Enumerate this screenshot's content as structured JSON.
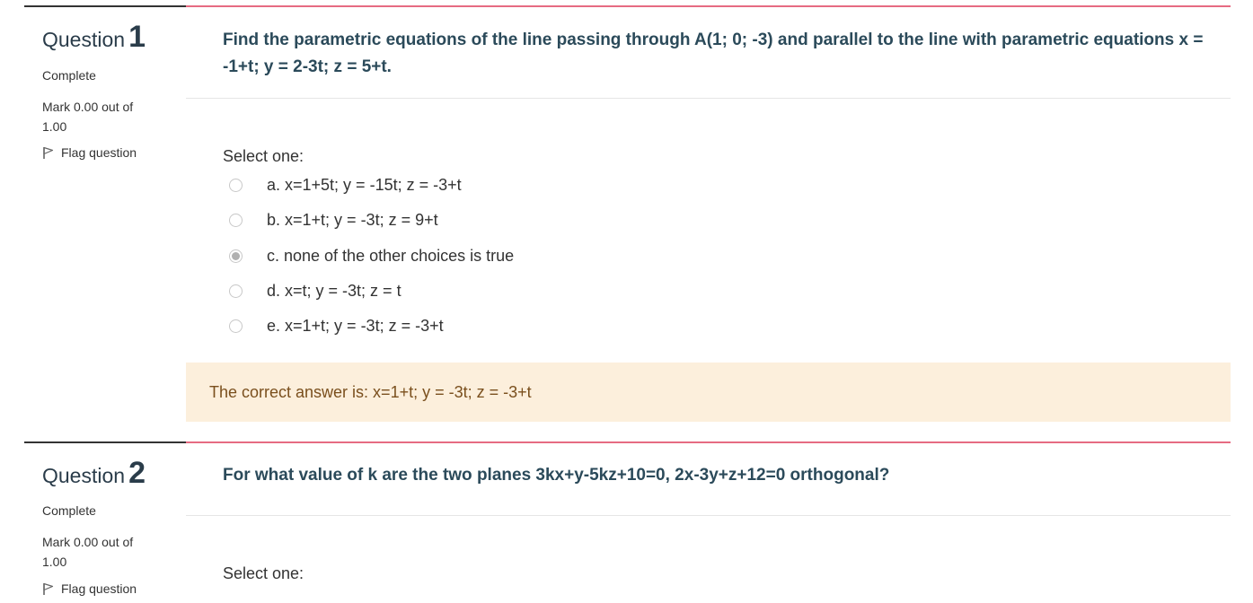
{
  "questions": [
    {
      "word": "Question",
      "number": "1",
      "state": "Complete",
      "grade": "Mark 0.00 out of 1.00",
      "flag_label": "Flag question",
      "text": "Find the parametric equations of the line passing through A(1; 0; -3) and parallel to the line with parametric equations x = -1+t; y = 2-3t; z = 5+t.",
      "prompt": "Select one:",
      "options": [
        {
          "label": "a. x=1+5t; y = -15t; z = -3+t",
          "checked": false
        },
        {
          "label": "b. x=1+t; y = -3t; z = 9+t",
          "checked": false
        },
        {
          "label": "c. none of the other choices is true",
          "checked": true
        },
        {
          "label": "d. x=t; y = -3t; z = t",
          "checked": false
        },
        {
          "label": "e. x=1+t; y = -3t; z = -3+t",
          "checked": false
        }
      ],
      "feedback": "The correct answer is: x=1+t; y = -3t; z = -3+t"
    },
    {
      "word": "Question",
      "number": "2",
      "state": "Complete",
      "grade": "Mark 0.00 out of 1.00",
      "flag_label": "Flag question",
      "text": "For what value of k are the two planes 3kx+y-5kz+10=0, 2x-3y+z+12=0 orthogonal?",
      "prompt": "Select one:"
    }
  ],
  "colors": {
    "accent_rule": "#e66b82",
    "question_text": "#2b4a5a",
    "feedback_bg": "#fcefdc",
    "feedback_text": "#7a4f1d"
  },
  "icons": {
    "flag": "flag-icon",
    "radio": "radio-button-icon"
  }
}
